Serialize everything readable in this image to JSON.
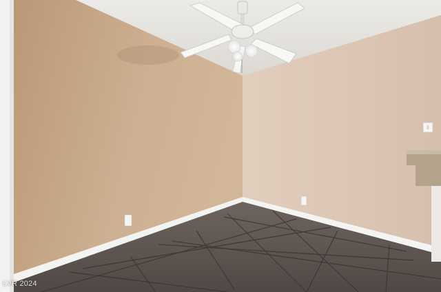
{
  "photo": {
    "subject": "empty-room",
    "watermark": "LVR 2024",
    "colors": {
      "left_wall": "#c8a888",
      "right_wall": "#dcc5b2",
      "ceiling": "#ece9e4",
      "baseboard": "#f4f4f2",
      "floor_tile": "#5e5550",
      "grout": "#3c3532",
      "counter": "#b8a890"
    }
  }
}
